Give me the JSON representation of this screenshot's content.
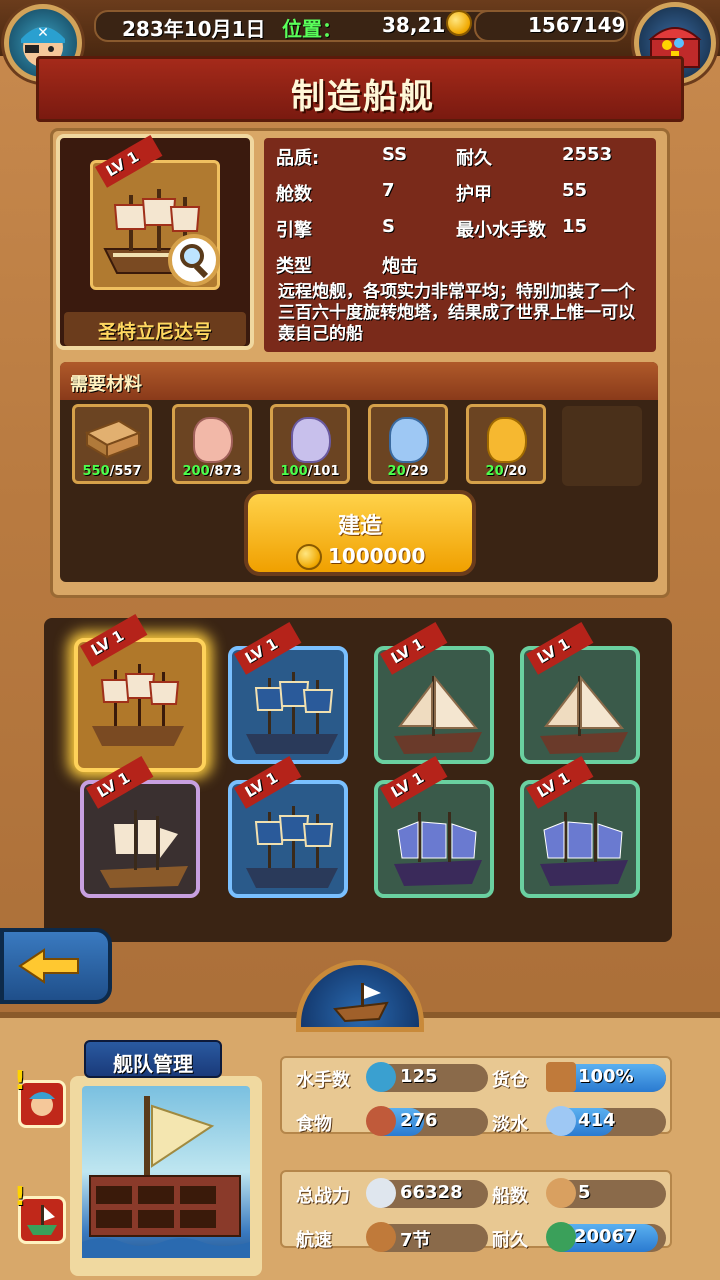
{
  "topbar": {
    "date": "283年10月1日",
    "position_label": "位置：",
    "position_value": "38,21",
    "gold": "1567149"
  },
  "title": "制造船舰",
  "ship": {
    "level": "LV 1",
    "name": "圣特立尼达号",
    "stats": {
      "quality_label": "品质:",
      "quality_value": "SS",
      "durability_label": "耐久",
      "durability_value": "2553",
      "cabins_label": "舱数",
      "cabins_value": "7",
      "armor_label": "护甲",
      "armor_value": "55",
      "engine_label": "引擎",
      "engine_value": "S",
      "min_crew_label": "最小水手数",
      "min_crew_value": "15",
      "type_label": "类型",
      "type_value": "炮击"
    },
    "description": "远程炮舰，各项实力非常平均；特别加装了一个三百六十度旋转炮塔，结果成了世界上惟一可以轰自己的船"
  },
  "materials": {
    "title": "需要材料",
    "items": [
      {
        "name": "wood",
        "have": "550",
        "need": "/557",
        "color": "#d9a060"
      },
      {
        "name": "pink-ore",
        "have": "200",
        "need": "/873",
        "color": "#f2b8a8"
      },
      {
        "name": "purple-ore",
        "have": "100",
        "need": "/101",
        "color": "#c8c0ec"
      },
      {
        "name": "blue-ore",
        "have": "20",
        "need": "/29",
        "color": "#9ec8f4"
      },
      {
        "name": "gold-ore",
        "have": "20",
        "need": "/20",
        "color": "#f6b830"
      }
    ]
  },
  "build": {
    "label": "建造",
    "cost": "1000000"
  },
  "ship_list": [
    {
      "level": "LV 1",
      "rarity": "orange",
      "selected": true
    },
    {
      "level": "LV 1",
      "rarity": "blue"
    },
    {
      "level": "LV 1",
      "rarity": "green"
    },
    {
      "level": "LV 1",
      "rarity": "green"
    },
    {
      "level": "LV 1",
      "rarity": "purple"
    },
    {
      "level": "LV 1",
      "rarity": "blue"
    },
    {
      "level": "LV 1",
      "rarity": "green"
    },
    {
      "level": "LV 1",
      "rarity": "green"
    }
  ],
  "fleet": {
    "tab_label": "舰队管理",
    "sailors_label": "水手数",
    "sailors_value": "125",
    "cargo_label": "货仓",
    "cargo_value": "100%",
    "cargo_fill": 1.0,
    "food_label": "食物",
    "food_value": "276",
    "water_label": "淡水",
    "water_value": "414",
    "power_label": "总战力",
    "power_value": "66328",
    "ships_label": "船数",
    "ships_value": "5",
    "speed_label": "航速",
    "speed_value": "7节",
    "durability_label": "耐久",
    "durability_value": "20067"
  },
  "alerts": [
    "!",
    "!"
  ]
}
